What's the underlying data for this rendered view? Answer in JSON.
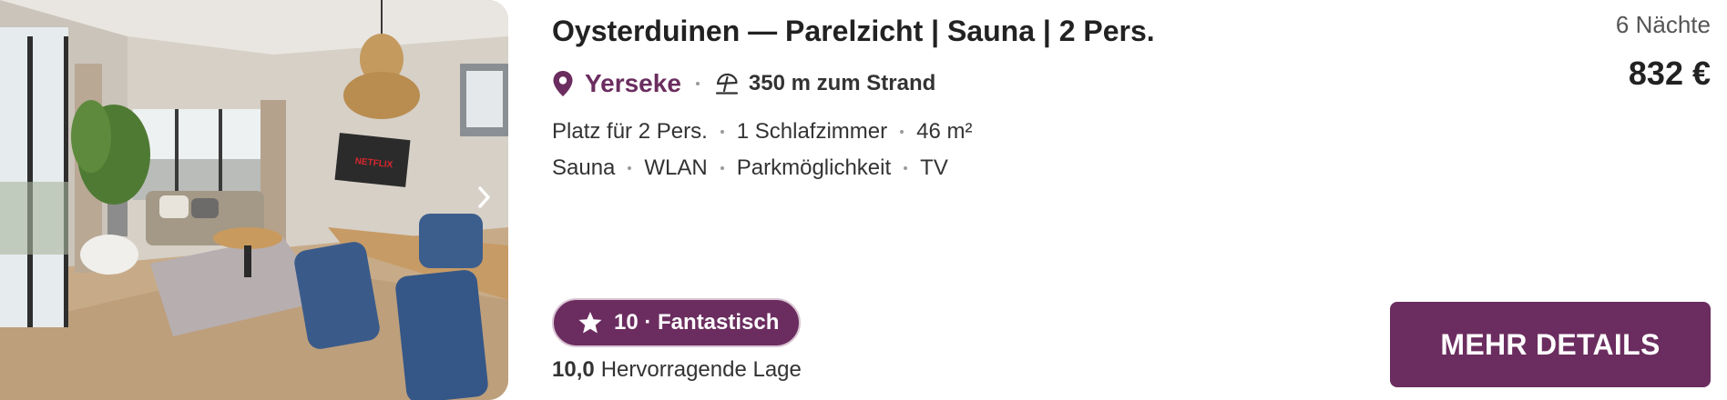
{
  "listing": {
    "title": "Oysterduinen — Parelzicht | Sauna | 2 Pers.",
    "location": {
      "city": "Yerseke",
      "pin_icon": "map-pin-icon",
      "beach_icon": "beach-umbrella-icon",
      "beach_distance": "350 m zum Strand"
    },
    "facts": [
      "Platz für 2 Pers.",
      "1 Schlafzimmer",
      "46 m²"
    ],
    "amenities": [
      "Sauna",
      "WLAN",
      "Parkmöglichkeit",
      "TV"
    ],
    "rating": {
      "icon": "star-icon",
      "label": "10 · Fantastisch"
    },
    "location_score": {
      "value": "10,0",
      "label": "Hervorragende Lage"
    },
    "photo": {
      "next_icon": "chevron-right-icon",
      "tv_logo": "NETFLIX"
    }
  },
  "pricing": {
    "nights": "6 Nächte",
    "total": "832 €"
  },
  "actions": {
    "details_label": "MEHR DETAILS"
  },
  "colors": {
    "brand": "#6b2d5f",
    "brand_border": "#d9c4d3",
    "text": "#333333"
  }
}
